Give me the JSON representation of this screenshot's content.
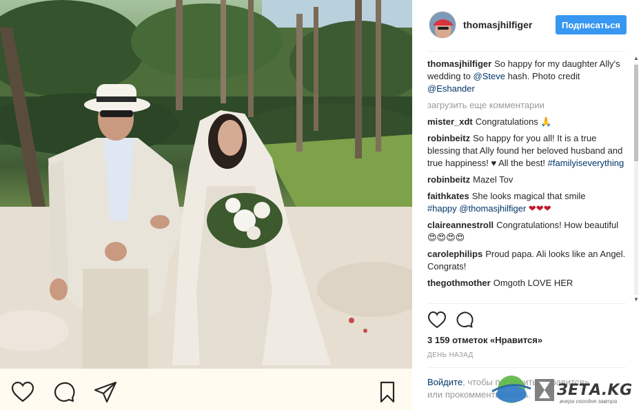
{
  "post": {
    "username": "thomasjhilfiger",
    "follow_label": "Подписаться",
    "caption_text": "So happy for my daughter Ally's wedding to ",
    "caption_mention_1": "@Steve",
    "caption_text_2": " hash. Photo credit ",
    "caption_mention_2": "@Eshander",
    "load_more": "загрузить еще комментарии"
  },
  "comments": [
    {
      "user": "mister_xdt",
      "text": "Congratulations 🙏"
    },
    {
      "user": "robinbeitz",
      "text": "So happy for you all! It is a true blessing that Ally found her beloved husband and true happiness! ♥ All the best! ",
      "tag": "#familyiseverything"
    },
    {
      "user": "robinbeitz",
      "text": "Mazel Tov"
    },
    {
      "user": "faithkates",
      "text": "She looks magical that smile ",
      "tag": "#happy",
      "mention": "@thomasjhilfiger",
      "tail": " ❤❤❤"
    },
    {
      "user": "claireannestroll",
      "text": "Congratulations! How beautiful😍😍😍😍"
    },
    {
      "user": "carolephilips",
      "text": "Proud papa. Ali looks like an Angel. Congrats!"
    },
    {
      "user": "thegothmother",
      "text": "Omgoth LOVE HER"
    }
  ],
  "stats": {
    "likes": "3 159 отметок «Нравится»",
    "date": "ДЕНЬ НАЗАД"
  },
  "login_prompt": {
    "login_link": "Войдите",
    "text_1": ", чтобы поставить «Нравится»",
    "text_2": "или прокомментировать."
  },
  "icons": {
    "like": "heart-icon",
    "comment": "comment-icon",
    "share": "share-icon",
    "save": "bookmark-icon"
  },
  "watermark": {
    "brand": "ЗЕТА.KG",
    "tagline": "вчера сегодня завтра"
  },
  "colors": {
    "follow_button": "#3897f0",
    "link": "#003569",
    "muted": "#999999",
    "heart": "#ed4956"
  }
}
